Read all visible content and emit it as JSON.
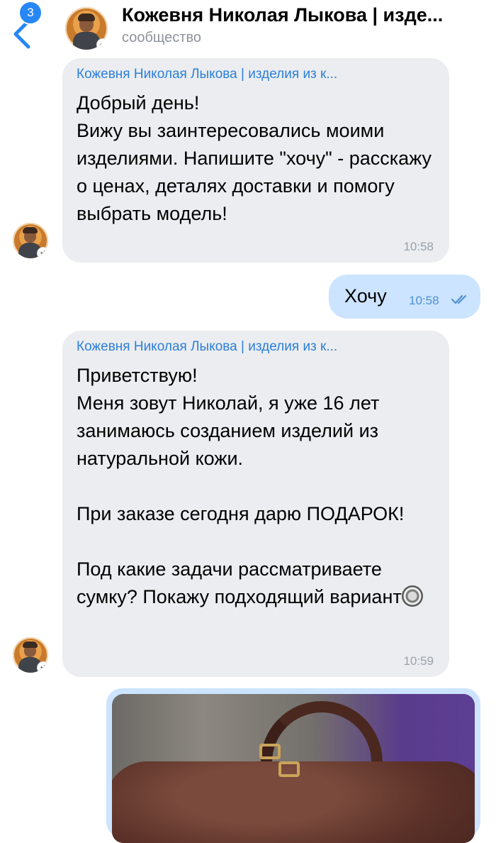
{
  "header": {
    "unread_badge": "3",
    "title": "Кожевня Николая Лыкова | изде...",
    "subtitle": "сообщество"
  },
  "messages": [
    {
      "sender": "Кожевня Николая Лыкова | изделия из к...",
      "text": "Добрый день!\nВижу вы заинтересовались моими изделиями. Напишите \"хочу\" - расскажу о ценах, деталях доставки и помогу выбрать модель!",
      "time": "10:58"
    },
    {
      "text": "Хочу",
      "time": "10:58",
      "status_icon": "double-check-icon"
    },
    {
      "sender": "Кожевня Николая Лыкова | изделия из к...",
      "text": "Приветствую!\nМеня зовут Николай, я уже 16 лет занимаюсь созданием изделий из натуральной кожи.\n\nПри заказе сегодня дарю ПОДАРОК!\n\nПод какие задачи рассматриваете сумку? Покажу подходящий вариант",
      "emoji": "radio-button-emoji",
      "time": "10:59"
    }
  ],
  "colors": {
    "accent": "#2787f5",
    "incoming_bubble": "#ebedf0",
    "outgoing_bubble": "#cce4ff",
    "sender_name": "#2c7fd9",
    "time_gray": "#99a2ad"
  }
}
